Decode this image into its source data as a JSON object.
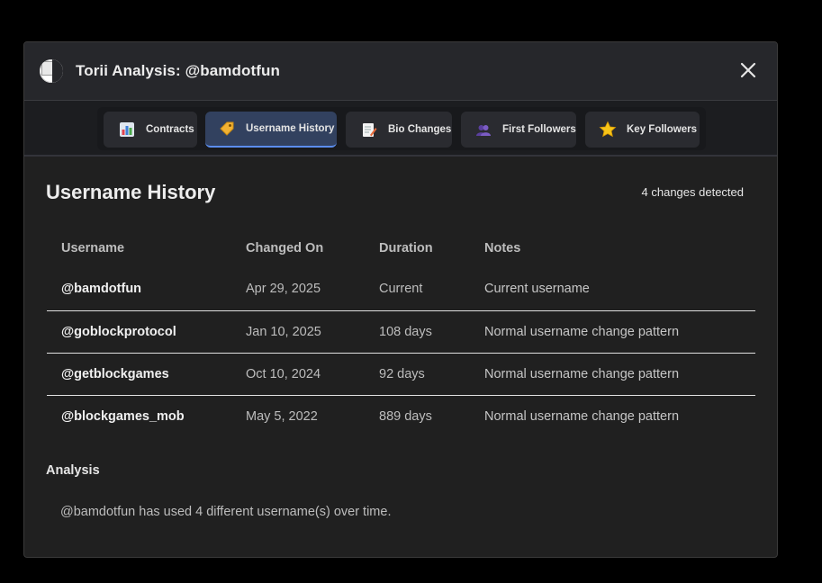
{
  "window": {
    "title": "Torii Analysis: @bamdotfun",
    "close_icon": "close-icon"
  },
  "tabs": [
    {
      "label": "Contracts",
      "icon": "bar-chart-icon",
      "active": false
    },
    {
      "label": "Username History",
      "icon": "tag-icon",
      "active": true
    },
    {
      "label": "Bio Changes",
      "icon": "memo-icon",
      "active": false
    },
    {
      "label": "First Followers",
      "icon": "users-icon",
      "active": false
    },
    {
      "label": "Key Followers",
      "icon": "star-icon",
      "active": false
    }
  ],
  "section": {
    "title": "Username History",
    "count_text": "4 changes detected"
  },
  "table": {
    "headers": [
      "Username",
      "Changed On",
      "Duration",
      "Notes"
    ],
    "rows": [
      {
        "username": "@bamdotfun",
        "changed_on": "Apr 29, 2025",
        "duration": "Current",
        "notes": "Current username"
      },
      {
        "username": "@goblockprotocol",
        "changed_on": "Jan 10, 2025",
        "duration": "108 days",
        "notes": "Normal username change pattern"
      },
      {
        "username": "@getblockgames",
        "changed_on": "Oct 10, 2024",
        "duration": "92 days",
        "notes": "Normal username change pattern"
      },
      {
        "username": "@blockgames_mob",
        "changed_on": "May 5, 2022",
        "duration": "889 days",
        "notes": "Normal username change pattern"
      }
    ]
  },
  "analysis": {
    "title": "Analysis",
    "text": "@bamdotfun has used 4 different username(s) over time."
  },
  "colors": {
    "background": "#000000",
    "modal": "#202020",
    "header": "#26272b",
    "active_tab": "#32415f",
    "accent": "#5b8def"
  }
}
